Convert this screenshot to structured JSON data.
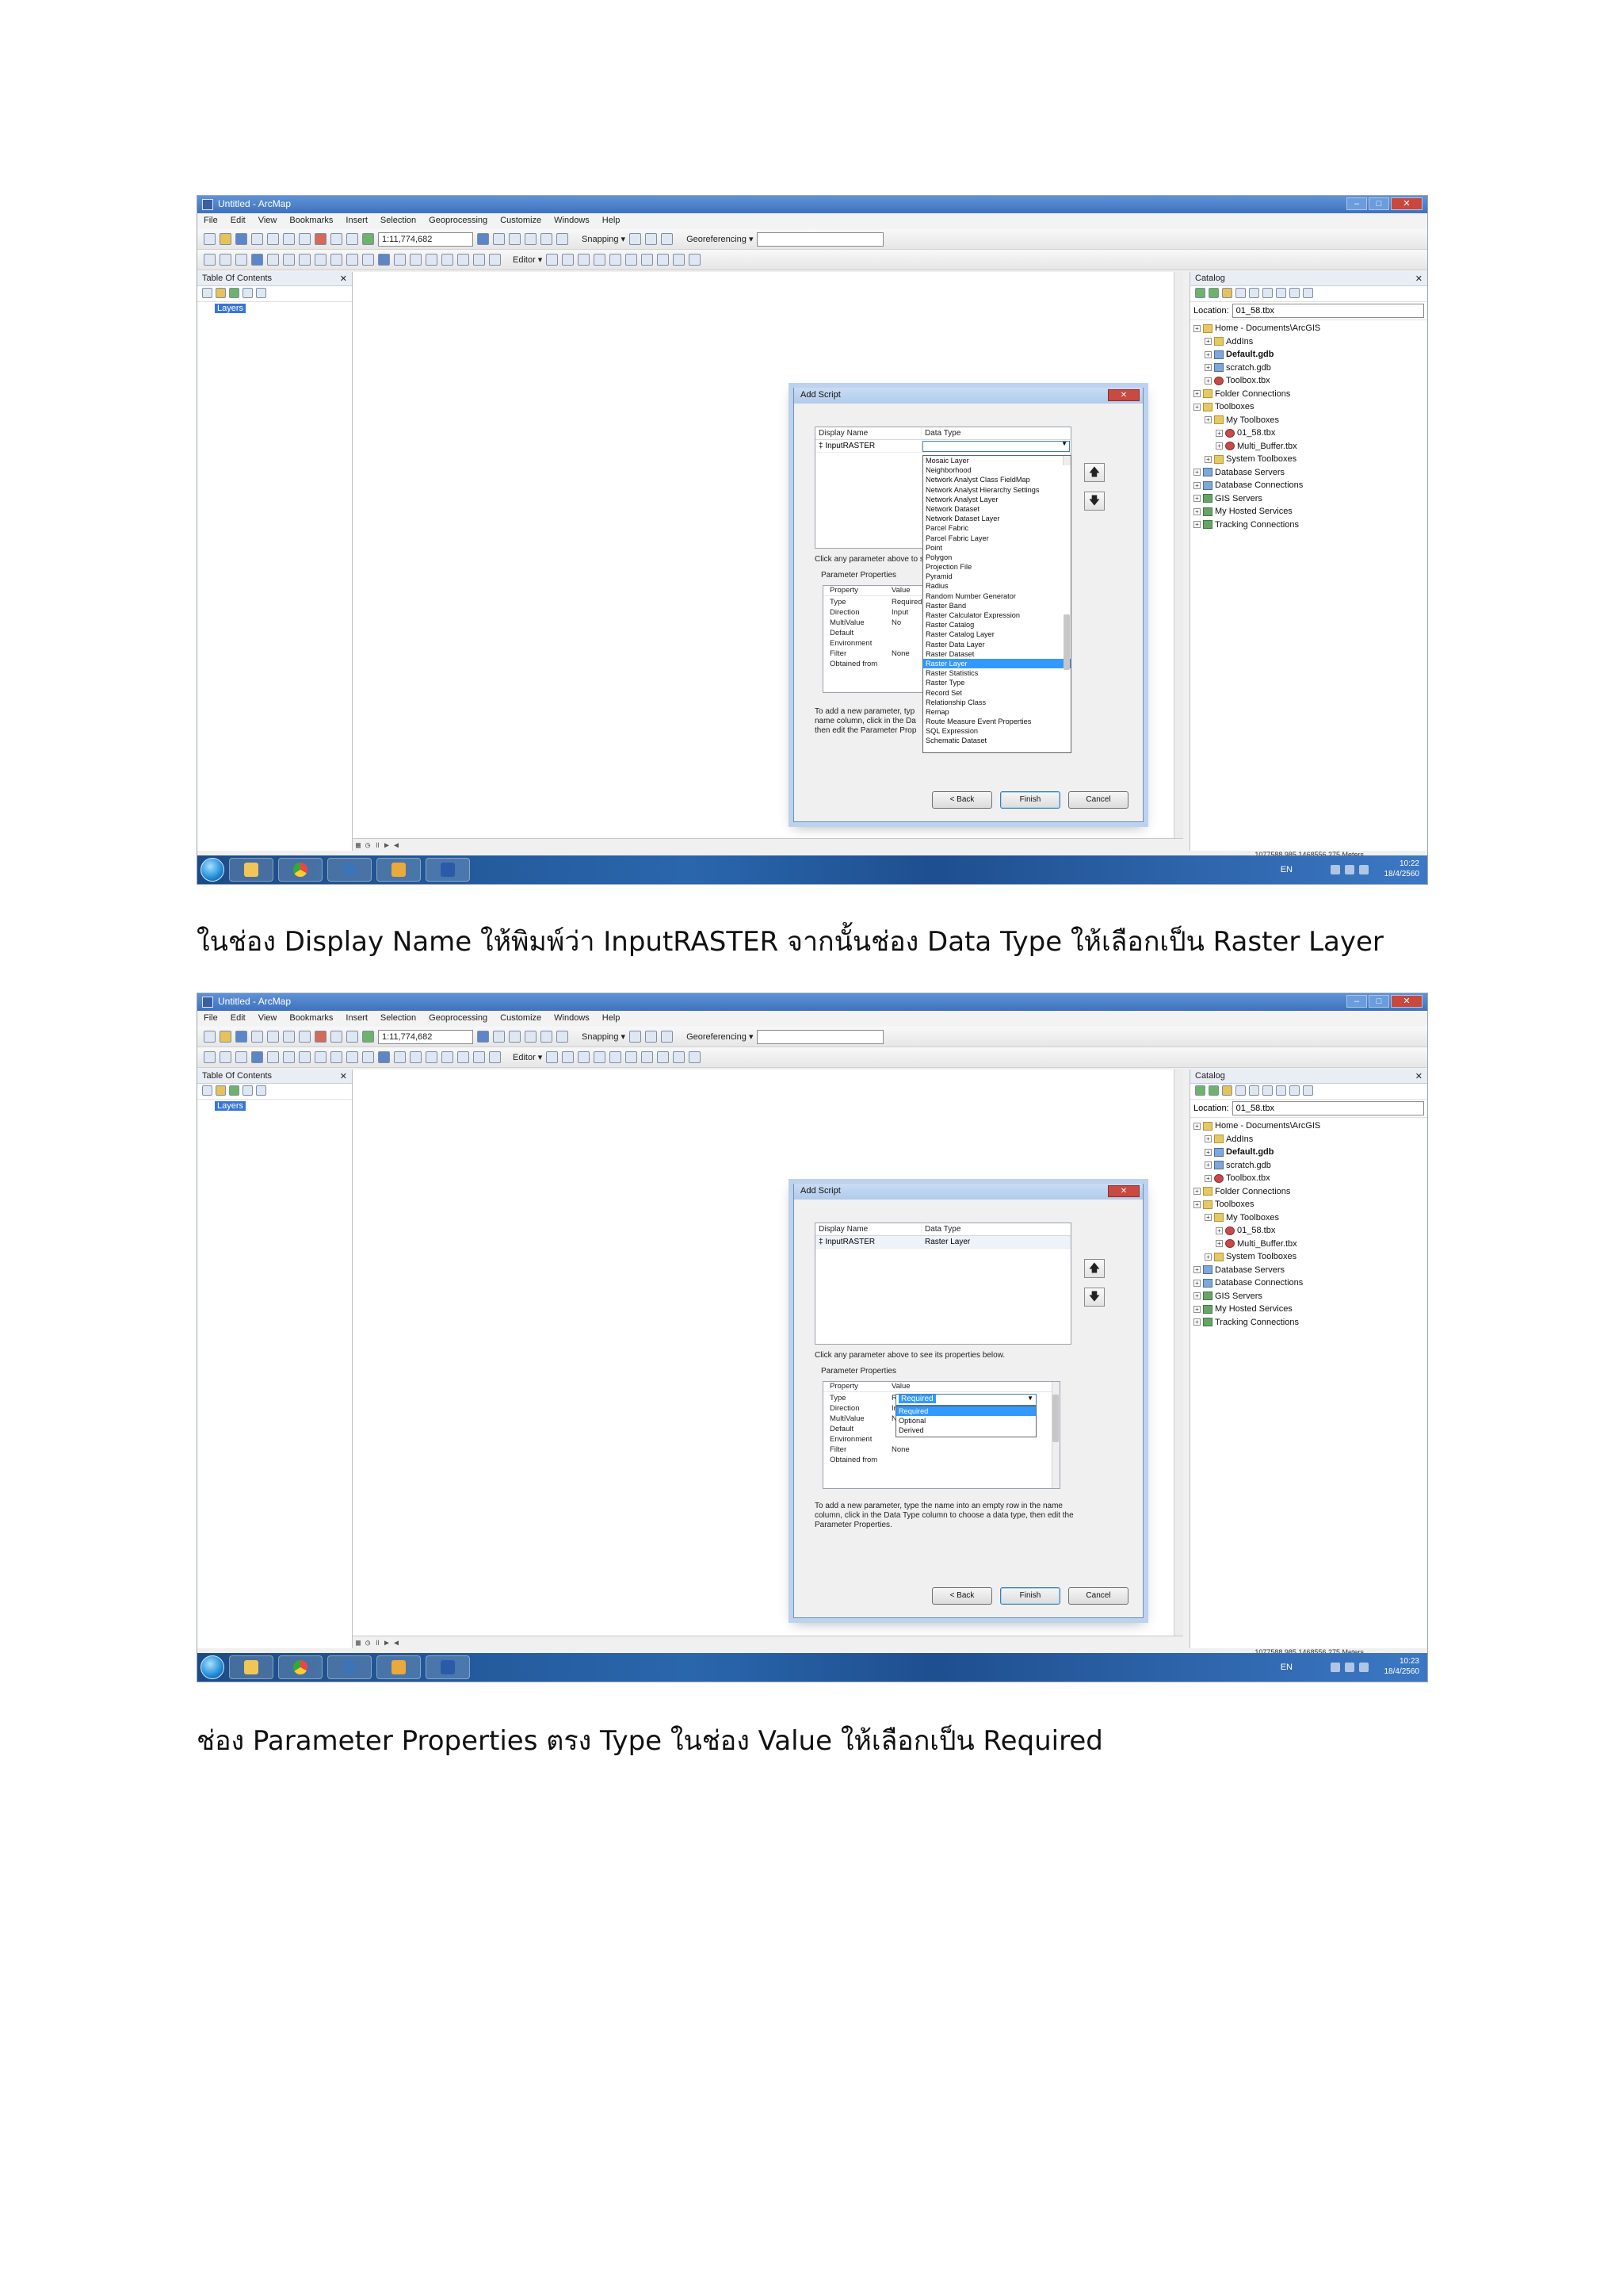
{
  "captions": {
    "first": "ในช่อง Display Name ให้พิมพ์ว่า InputRASTER จากนั้นช่อง Data Type ให้เลือกเป็น Raster Layer",
    "second": "ช่อง Parameter Properties  ตรง Type ในช่อง Value ให้เลือกเป็น Required"
  },
  "app": {
    "window_title": "Untitled - ArcMap",
    "menus": [
      "File",
      "Edit",
      "View",
      "Bookmarks",
      "Insert",
      "Selection",
      "Geoprocessing",
      "Customize",
      "Windows",
      "Help"
    ],
    "scale": "1:11,774,682",
    "snapping_label": "Snapping ▾",
    "georeferencing_label": "Georeferencing ▾",
    "editor_label": "Editor ▾",
    "toc_title": "Table Of Contents",
    "layers_label": "Layers",
    "catalog_title": "Catalog",
    "location_label": "Location:",
    "location_value": "01_58.tbx",
    "coordinates": "1077588.985  1468556.275 Meters",
    "taskbar_lang": "EN",
    "time_1": "10:22",
    "time_2": "10:23",
    "date": "18/4/2560"
  },
  "catalog_tree": [
    {
      "label": "Home - Documents\\ArcGIS",
      "level": 0,
      "icon": "folder"
    },
    {
      "label": "AddIns",
      "level": 1,
      "icon": "folder"
    },
    {
      "label": "Default.gdb",
      "level": 1,
      "icon": "gdb",
      "bold": true
    },
    {
      "label": "scratch.gdb",
      "level": 1,
      "icon": "gdb"
    },
    {
      "label": "Toolbox.tbx",
      "level": 1,
      "icon": "toolbox"
    },
    {
      "label": "Folder Connections",
      "level": 0,
      "icon": "folder"
    },
    {
      "label": "Toolboxes",
      "level": 0,
      "icon": "folder"
    },
    {
      "label": "My Toolboxes",
      "level": 1,
      "icon": "folder"
    },
    {
      "label": "01_58.tbx",
      "level": 2,
      "icon": "toolbox"
    },
    {
      "label": "Multi_Buffer.tbx",
      "level": 2,
      "icon": "toolbox"
    },
    {
      "label": "System Toolboxes",
      "level": 1,
      "icon": "folder"
    },
    {
      "label": "Database Servers",
      "level": 0,
      "icon": "db"
    },
    {
      "label": "Database Connections",
      "level": 0,
      "icon": "db"
    },
    {
      "label": "GIS Servers",
      "level": 0,
      "icon": "server"
    },
    {
      "label": "My Hosted Services",
      "level": 0,
      "icon": "server"
    },
    {
      "label": "Tracking Connections",
      "level": 0,
      "icon": "server"
    }
  ],
  "dialog": {
    "title": "Add Script",
    "col_display_name": "Display Name",
    "col_data_type": "Data Type",
    "row_display_name": "InputRASTER",
    "row_data_type_step2": "Raster Layer",
    "click_hint": "Click any parameter above to see its properties below.",
    "click_hint_truncated": "Click any parameter above to s",
    "parameter_properties": "Parameter Properties",
    "prop_header_property": "Property",
    "prop_header_value": "Value",
    "properties": [
      {
        "k": "Type",
        "v": "Required"
      },
      {
        "k": "Direction",
        "v": "Input"
      },
      {
        "k": "MultiValue",
        "v": "No"
      },
      {
        "k": "Default",
        "v": ""
      },
      {
        "k": "Environment",
        "v": ""
      },
      {
        "k": "Filter",
        "v": "None"
      },
      {
        "k": "Obtained from",
        "v": ""
      }
    ],
    "help_text": "To add a new parameter, type the name into an empty row in the name column, click in the Data Type column to choose a data type, then edit the Parameter Properties.",
    "help_text_truncated_lines": [
      "To add a new parameter, typ",
      "name column, click in the Da",
      "then edit the Parameter Prop"
    ],
    "back_label": "< Back",
    "finish_label": "Finish",
    "cancel_label": "Cancel",
    "type_dropdown": [
      "Required",
      "Optional",
      "Derived"
    ],
    "type_selected": "Required",
    "data_type_list": [
      "Mosaic Layer",
      "Neighborhood",
      "Network Analyst Class FieldMap",
      "Network Analyst Hierarchy Settings",
      "Network Analyst Layer",
      "Network Dataset",
      "Network Dataset Layer",
      "Parcel Fabric",
      "Parcel Fabric Layer",
      "Point",
      "Polygon",
      "Projection File",
      "Pyramid",
      "Radius",
      "Random Number Generator",
      "Raster Band",
      "Raster Calculator Expression",
      "Raster Catalog",
      "Raster Catalog Layer",
      "Raster Data Layer",
      "Raster Dataset",
      "Raster Layer",
      "Raster Statistics",
      "Raster Type",
      "Record Set",
      "Relationship Class",
      "Remap",
      "Route Measure Event Properties",
      "SQL Expression",
      "Schematic Dataset"
    ],
    "data_type_selected": "Raster Layer"
  }
}
